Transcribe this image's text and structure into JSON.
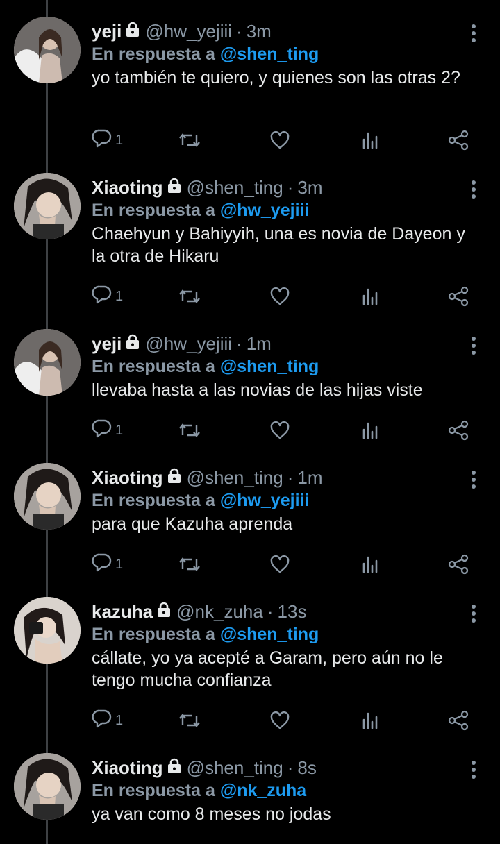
{
  "reply_prefix": "En respuesta a",
  "tweets": [
    {
      "name": "yeji",
      "handle": "@hw_yejiii",
      "time": "3m",
      "reply_to": "@shen_ting",
      "text": "yo también te quiero, y quienes son las otras 2?",
      "replies": "1",
      "avatar": "yeji-avatar"
    },
    {
      "name": "Xiaoting",
      "handle": "@shen_ting",
      "time": "3m",
      "reply_to": "@hw_yejiii",
      "text": "Chaehyun y Bahiyyih, una es novia de Dayeon y la otra de Hikaru",
      "replies": "1",
      "avatar": "xiaoting-avatar"
    },
    {
      "name": "yeji",
      "handle": "@hw_yejiii",
      "time": "1m",
      "reply_to": "@shen_ting",
      "text": "llevaba hasta a las novias de las hijas viste",
      "replies": "1",
      "avatar": "yeji-avatar"
    },
    {
      "name": "Xiaoting",
      "handle": "@shen_ting",
      "time": "1m",
      "reply_to": "@hw_yejiii",
      "text": "para que Kazuha aprenda",
      "replies": "1",
      "avatar": "xiaoting-avatar"
    },
    {
      "name": "kazuha",
      "handle": "@nk_zuha",
      "time": "13s",
      "reply_to": "@shen_ting",
      "text": "cállate, yo ya acepté a Garam, pero aún no le tengo mucha confianza",
      "replies": "1",
      "avatar": "kazuha-avatar"
    },
    {
      "name": "Xiaoting",
      "handle": "@shen_ting",
      "time": "8s",
      "reply_to": "@nk_zuha",
      "text": "ya van como 8 meses no jodas",
      "replies": "",
      "avatar": "xiaoting-avatar"
    }
  ],
  "colors": {
    "background": "#000000",
    "muted": "#8b98a5",
    "link": "#1d9bf0",
    "text": "#e7e9ea",
    "thread_line": "#3e4144"
  },
  "icons": [
    "lock-icon",
    "more-icon",
    "reply-icon",
    "retweet-icon",
    "like-icon",
    "stats-icon",
    "share-icon"
  ]
}
